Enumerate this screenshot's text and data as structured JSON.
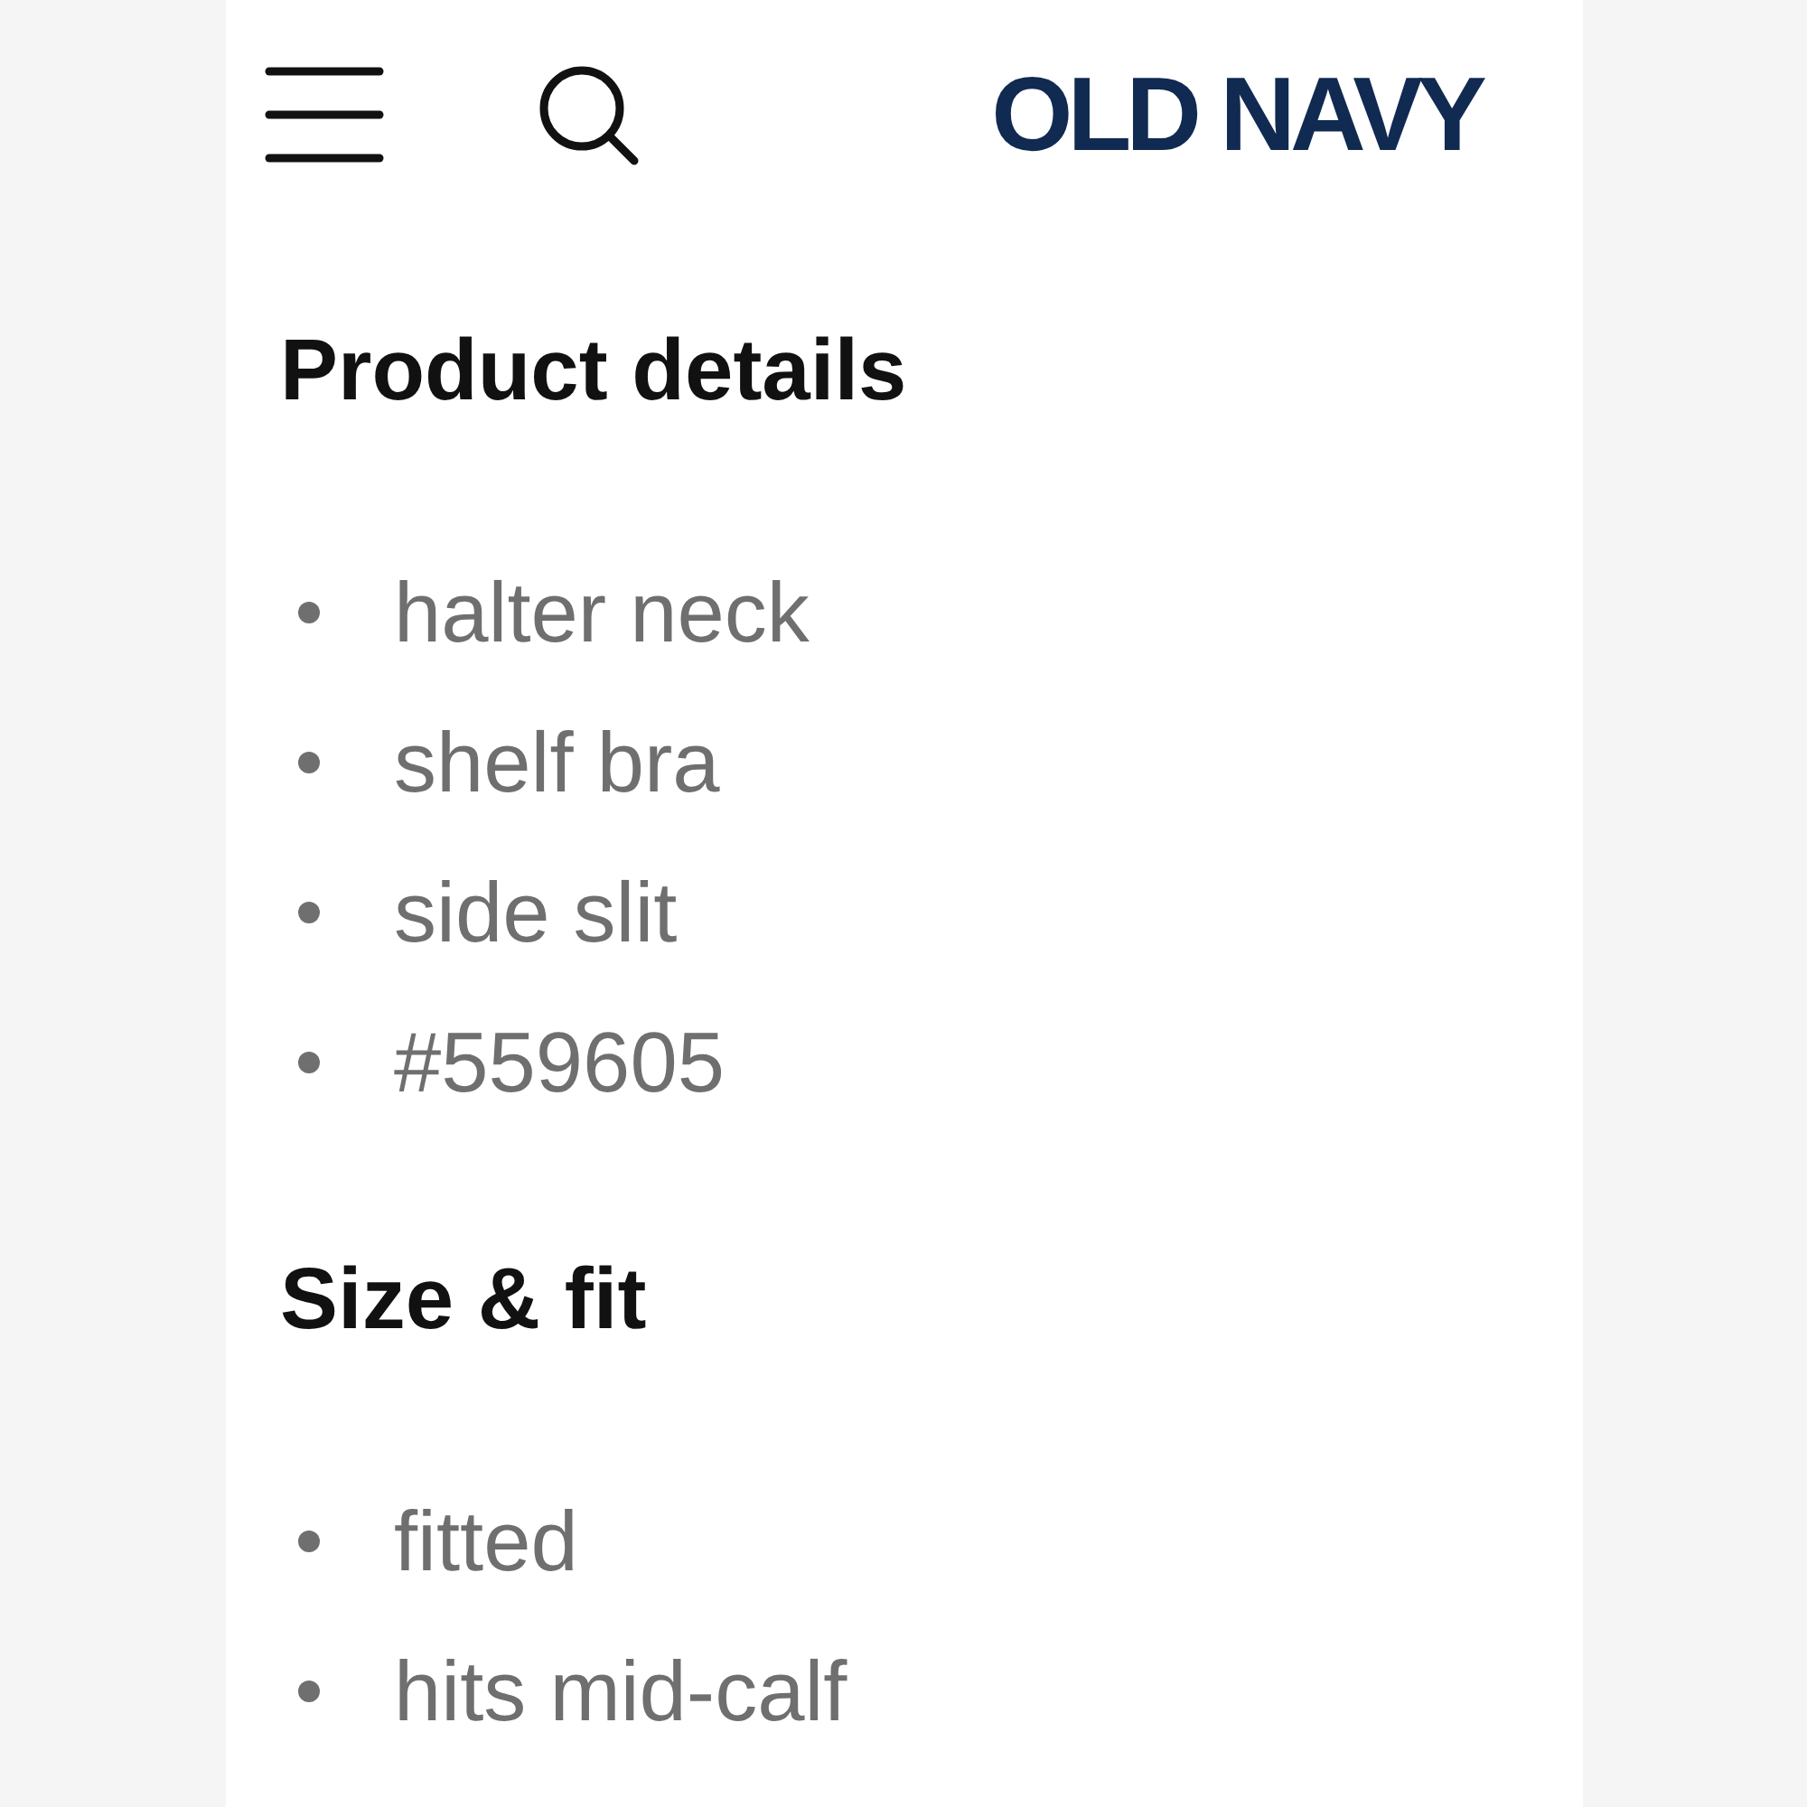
{
  "header": {
    "logo": "OLD NAVY"
  },
  "sections": [
    {
      "title": "Product details",
      "items": [
        "halter neck",
        "shelf bra",
        "side slit",
        "#559605"
      ]
    },
    {
      "title": "Size & fit",
      "items": [
        "fitted",
        "hits mid-calf"
      ]
    }
  ]
}
